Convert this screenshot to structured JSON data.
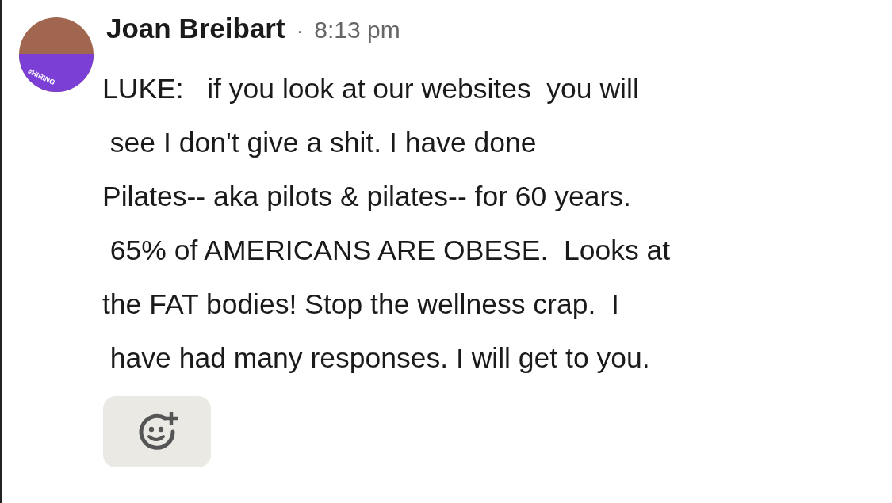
{
  "message": {
    "avatar": {
      "frame_text": "#HIRING"
    },
    "sender": "Joan Breibart",
    "separator": "·",
    "time": "8:13 pm",
    "text": "LUKE:   if you look at our websites  you will\n see I don't give a shit. I have done\nPilates-- aka pilots & pilates-- for 60 years.\n 65% of AMERICANS ARE OBESE.  Looks at\nthe FAT bodies! Stop the wellness crap.  I\n have had many responses. I will get to you."
  }
}
